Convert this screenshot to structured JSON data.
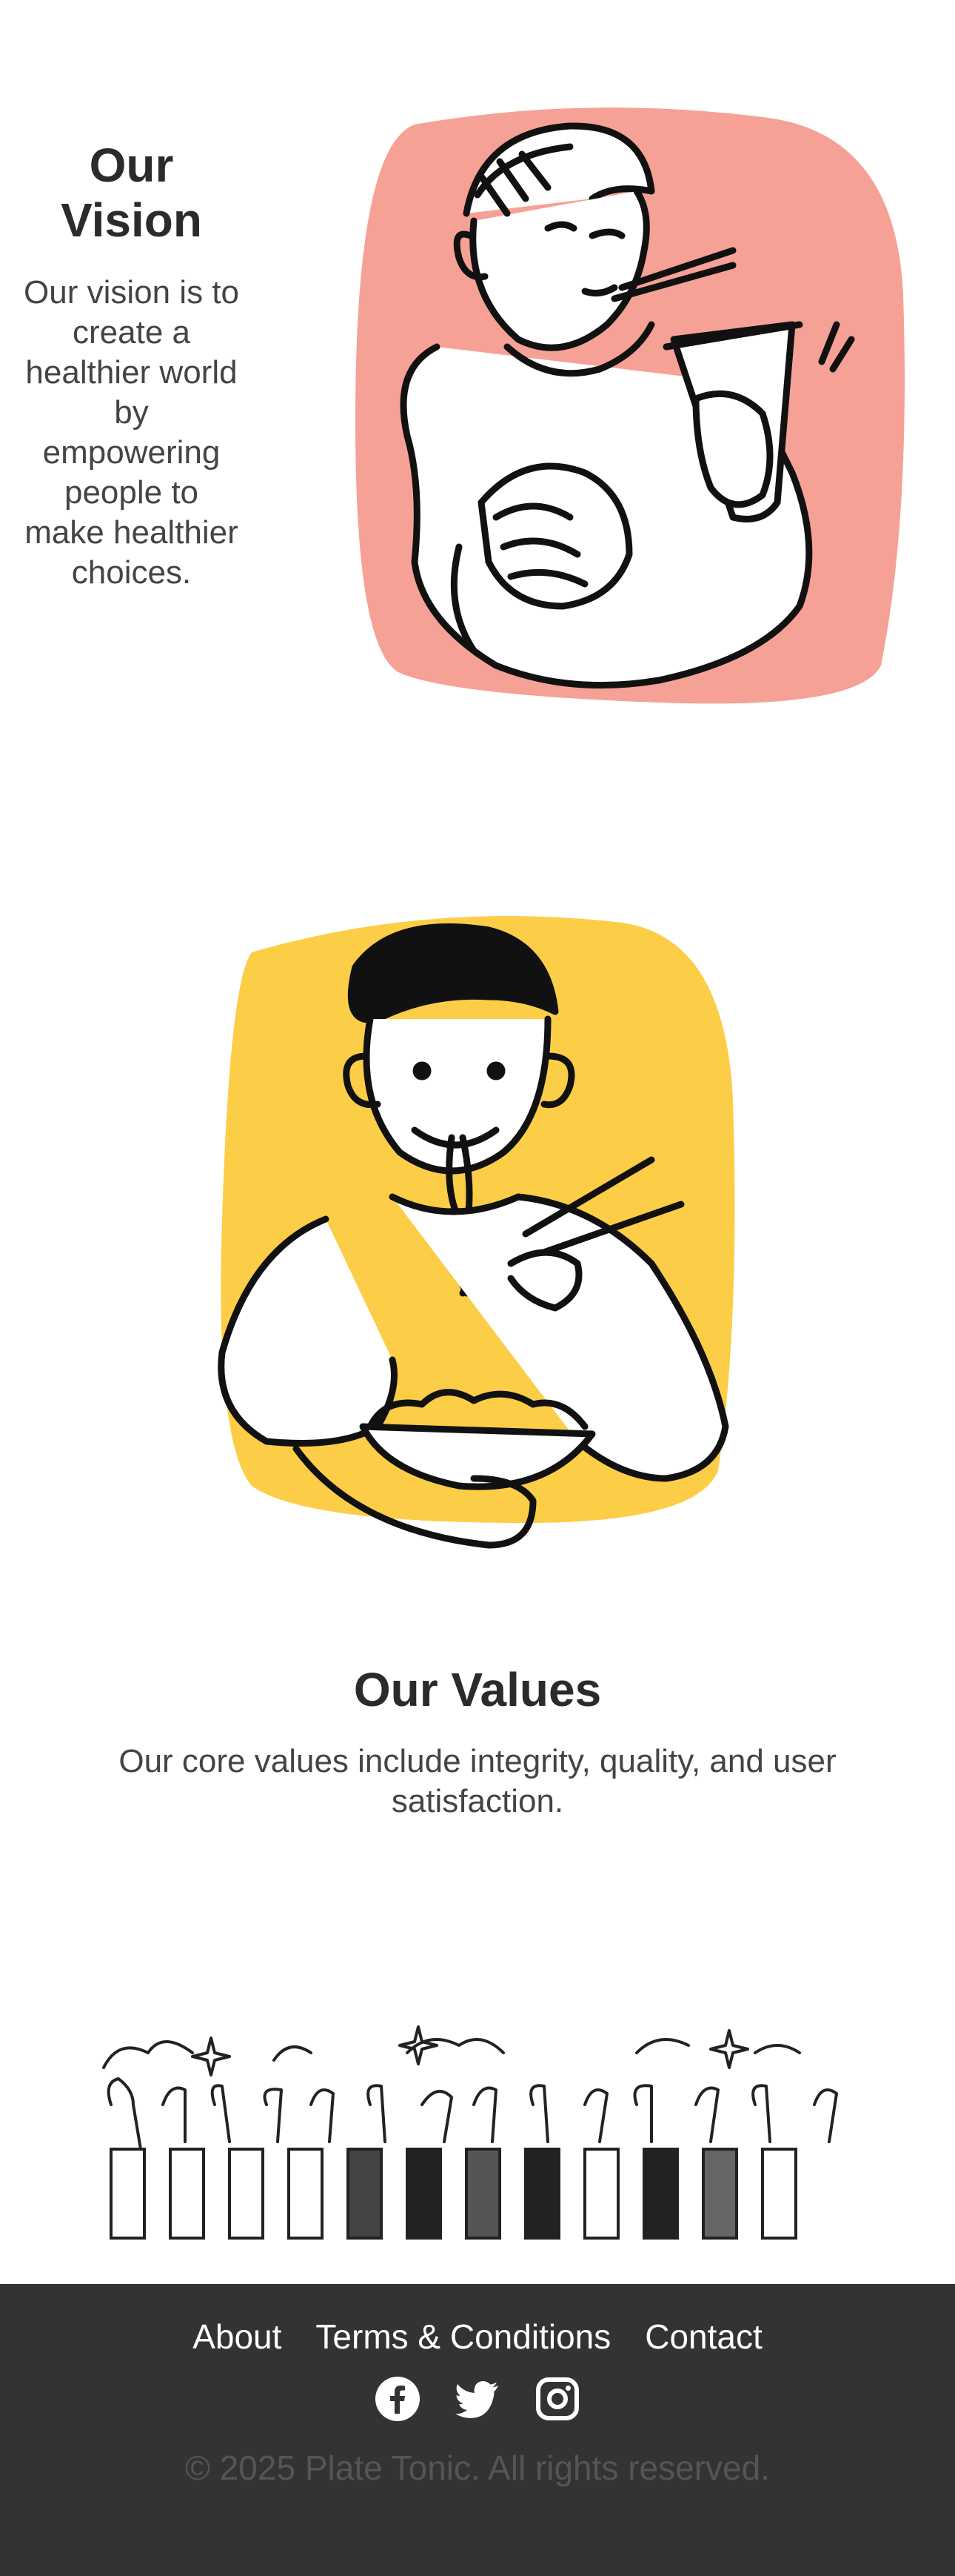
{
  "vision": {
    "title": "Our Vision",
    "text": "Our vision is to create a healthier world by empowering people to make healthier choices.",
    "illustration_accent": "#f6a195"
  },
  "second_illustration": {
    "accent": "#fccd46"
  },
  "values": {
    "title": "Our Values",
    "text": "Our core values include integrity, quality, and user satisfaction."
  },
  "footer": {
    "background": "#333333",
    "links": [
      "About",
      "Terms & Conditions",
      "Contact"
    ],
    "social_icons": [
      "facebook-icon",
      "twitter-icon",
      "instagram-icon"
    ],
    "copyright": "© 2025 Plate Tonic. All rights reserved."
  }
}
